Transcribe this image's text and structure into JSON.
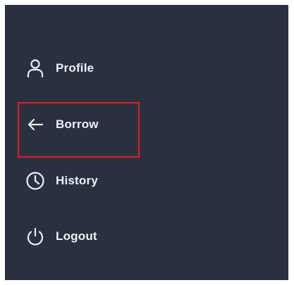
{
  "sidebar": {
    "items": [
      {
        "label": "Profile",
        "icon": "user-icon"
      },
      {
        "label": "Borrow",
        "icon": "arrow-left-icon"
      },
      {
        "label": "History",
        "icon": "clock-icon"
      },
      {
        "label": "Logout",
        "icon": "power-icon"
      }
    ]
  },
  "colors": {
    "sidebar_background": "#2b3040",
    "text": "#eef0f6",
    "icon": "#eef0f6",
    "highlight_border": "#e21c1c",
    "page_background": "#ffffff"
  }
}
